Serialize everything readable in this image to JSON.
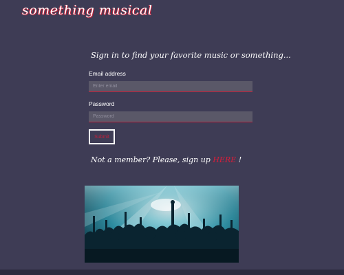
{
  "header": {
    "brand": "something musical"
  },
  "login": {
    "heading": "Sign in to find your favorite music or something...",
    "email_label": "Email address",
    "email_placeholder": "Enter email",
    "email_value": "",
    "password_label": "Password",
    "password_placeholder": "Password",
    "password_value": "",
    "submit_label": "Submit"
  },
  "signup": {
    "prefix": "Not a member? Please, sign up ",
    "link": "HERE",
    "suffix": " !"
  },
  "colors": {
    "background": "#3e3c55",
    "accent": "#c0203a",
    "field_background": "#5a5868",
    "text": "#ffffff"
  }
}
